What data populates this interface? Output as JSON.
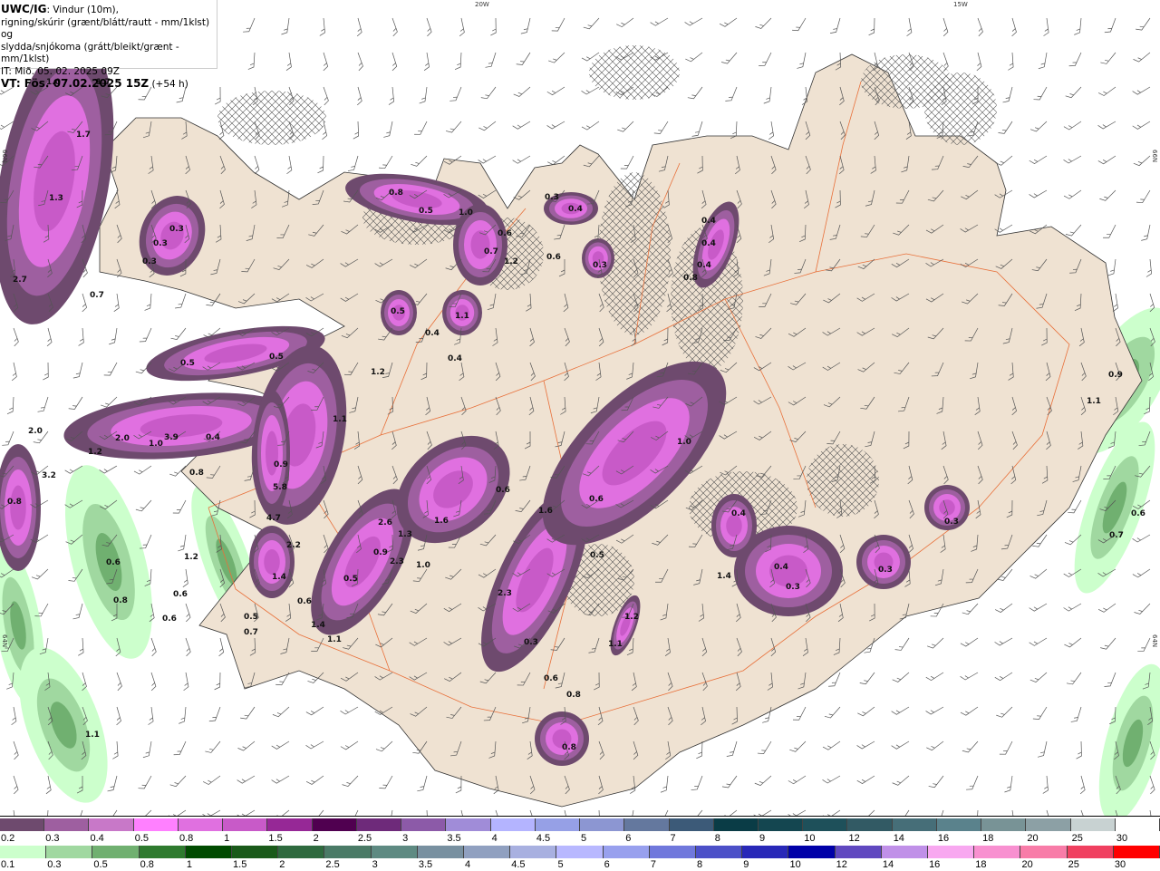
{
  "header": {
    "model": "UWC/IG",
    "line1": ": Vindur (10m),",
    "line2": "rigning/skúrir (grænt/blátt/rautt - mm/1klst) og",
    "line3": "slydda/snjókoma (grátt/bleikt/grænt - mm/1klst)",
    "init_time": "IT: Mið. 05. 02. 2025 09Z",
    "valid_time": "VT: Fös. 07.02.2025 15Z",
    "lead_time": " (+54 h)"
  },
  "map": {
    "grid_labels": [
      "20W",
      "15W",
      "66N",
      "66N",
      "64N",
      "64N"
    ],
    "colors": {
      "land": "#efe2d2",
      "sea": "#ffffff",
      "roads": "#e8703a",
      "hatch": "#555555"
    },
    "values": [
      "1.0",
      "1.7",
      "1.7",
      "1.3",
      "0.3",
      "0.3",
      "0.3",
      "2.7",
      "0.7",
      "0.8",
      "0.5",
      "1.0",
      "0.7",
      "0.6",
      "1.2",
      "0.3",
      "0.4",
      "0.6",
      "0.3",
      "0.4",
      "0.4",
      "0.4",
      "0.8",
      "0.5",
      "0.4",
      "1.1",
      "0.4",
      "0.5",
      "0.5",
      "1.2",
      "2.0",
      "2.0",
      "1.0",
      "3.9",
      "0.4",
      "1.2",
      "3.2",
      "0.8",
      "0.8",
      "1.1",
      "0.9",
      "5.8",
      "4.7",
      "2.2",
      "1.4",
      "2.6",
      "1.3",
      "1.6",
      "0.6",
      "0.9",
      "2.3",
      "1.0",
      "0.5",
      "0.6",
      "1.4",
      "1.1",
      "2.3",
      "0.6",
      "1.6",
      "0.5",
      "0.3",
      "1.0",
      "1.2",
      "1.1",
      "0.4",
      "0.3",
      "0.3",
      "1.4",
      "0.4",
      "0.3",
      "0.8",
      "0.6",
      "0.8",
      "0.9",
      "1.1",
      "0.6",
      "0.7",
      "0.6",
      "0.8",
      "0.6",
      "0.6",
      "0.5",
      "0.7",
      "1.2",
      "1.1"
    ]
  },
  "legend": {
    "snow": {
      "labels": [
        "0.2",
        "0.3",
        "0.4",
        "0.5",
        "0.8",
        "1",
        "1.5",
        "2",
        "2.5",
        "3",
        "3.5",
        "4",
        "4.5",
        "5",
        "6",
        "7",
        "8",
        "9",
        "10",
        "12",
        "14",
        "16",
        "18",
        "20",
        "25",
        "30"
      ],
      "colors": [
        "#6e4a6e",
        "#9e5fa0",
        "#c878c8",
        "#ff80ff",
        "#e070e0",
        "#c85ac8",
        "#962896",
        "#500050",
        "#6e2a7a",
        "#8c5aa8",
        "#a08cd8",
        "#b4b4ff",
        "#96a0e6",
        "#8c96d2",
        "#64789e",
        "#3c5a78",
        "#0a3c46",
        "#144650",
        "#1e505a",
        "#325a64",
        "#466e78",
        "#5a828c",
        "#789396",
        "#8ca0a5",
        "#c8d2d2",
        "#ffffff"
      ]
    },
    "rain": {
      "labels": [
        "0.1",
        "0.3",
        "0.5",
        "0.8",
        "1",
        "1.5",
        "2",
        "2.5",
        "3",
        "3.5",
        "4",
        "4.5",
        "5",
        "6",
        "7",
        "8",
        "9",
        "10",
        "12",
        "14",
        "16",
        "18",
        "20",
        "25",
        "30"
      ],
      "colors": [
        "#ccffcc",
        "#a0d8a0",
        "#70b070",
        "#2e7a2e",
        "#004b00",
        "#1a5a1a",
        "#2e6a3e",
        "#4a7a66",
        "#5e8a82",
        "#7890a0",
        "#90a0c0",
        "#a8b0e0",
        "#b8b8ff",
        "#98a0ee",
        "#7078dc",
        "#4c50c8",
        "#2828b8",
        "#0000a8",
        "#6048c0",
        "#c090e8",
        "#f8a8f0",
        "#f890d0",
        "#f87ca8",
        "#f04060",
        "#ff0000"
      ]
    }
  }
}
